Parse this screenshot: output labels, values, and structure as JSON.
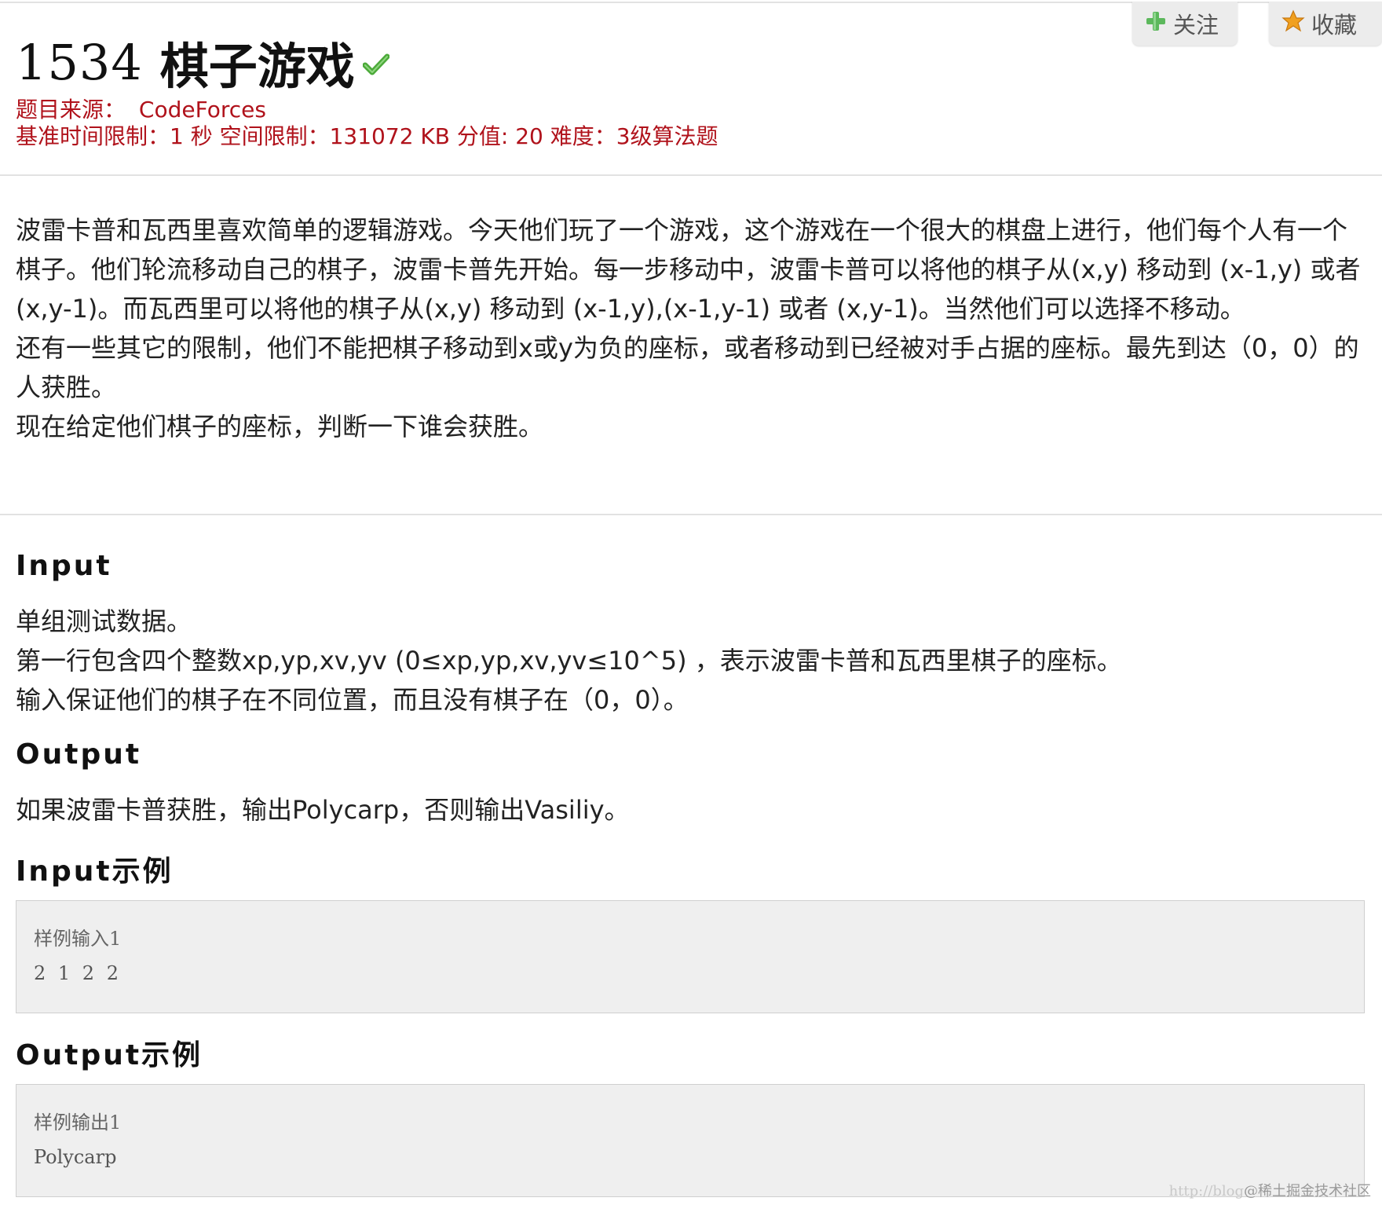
{
  "problem": {
    "id": "1534",
    "name": "棋子游戏",
    "source_label": "题目来源：",
    "source": "CodeForces",
    "limits": "基准时间限制：1 秒 空间限制：131072 KB 分值: 20 难度：3级算法题"
  },
  "actions": {
    "follow_label": "关注",
    "favorite_label": "收藏"
  },
  "description": [
    "波雷卡普和瓦西里喜欢简单的逻辑游戏。今天他们玩了一个游戏，这个游戏在一个很大的棋盘上进行，他们每个人有一个棋子。他们轮流移动自己的棋子，波雷卡普先开始。每一步移动中，波雷卡普可以将他的棋子从(x,y) 移动到 (x-1,y) 或者 (x,y-1)。而瓦西里可以将他的棋子从(x,y) 移动到 (x-1,y),(x-1,y-1) 或者 (x,y-1)。当然他们可以选择不移动。",
    "还有一些其它的限制，他们不能把棋子移动到x或y为负的座标，或者移动到已经被对手占据的座标。最先到达（0，0）的人获胜。",
    "现在给定他们棋子的座标，判断一下谁会获胜。"
  ],
  "input": {
    "heading": "Input",
    "lines": [
      "单组测试数据。",
      "第一行包含四个整数xp,yp,xv,yv (0≤xp,yp,xv,yv≤10^5) ，表示波雷卡普和瓦西里棋子的座标。",
      "输入保证他们的棋子在不同位置，而且没有棋子在（0，0）。"
    ]
  },
  "output": {
    "heading": "Output",
    "lines": [
      "如果波雷卡普获胜，输出Polycarp，否则输出Vasiliy。"
    ]
  },
  "input_sample": {
    "heading": "Input示例",
    "label": "样例输入1",
    "value": "2 1 2 2"
  },
  "output_sample": {
    "heading": "Output示例",
    "label": "样例输出1",
    "value": "Polycarp"
  },
  "watermark": {
    "url": "http://blog",
    "text": "@稀土掘金技术社区"
  },
  "colors": {
    "meta_red": "#b0121b",
    "check_green": "#4caa3a",
    "plus_green": "#5cb85c",
    "star_orange": "#f0a020"
  }
}
